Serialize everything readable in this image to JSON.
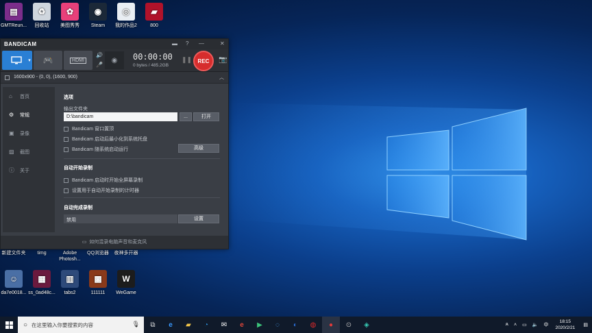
{
  "desktop": {
    "top_icons": [
      {
        "label": "GMTReun...",
        "color": "#7b2d8b",
        "glyph": "▤"
      },
      {
        "label": "回收站",
        "color": "#cfd6de",
        "glyph": "♻"
      },
      {
        "label": "美图秀秀",
        "color": "#e8407a",
        "glyph": "✿"
      },
      {
        "label": "Steam",
        "color": "#1b2838",
        "glyph": "◉"
      },
      {
        "label": "我的作品2",
        "color": "#e9eef3",
        "glyph": "◎"
      },
      {
        "label": "800",
        "color": "#b0122a",
        "glyph": "▰"
      }
    ],
    "mid_labels": [
      "新建文件夹",
      "timg",
      "Adobe Photosh...",
      "QQ浏览器",
      "夜神多开器"
    ],
    "bottom_icons": [
      {
        "label": "da7e0018...",
        "color": "#4a6fa5",
        "glyph": "☺"
      },
      {
        "label": "ss_0ad48c...",
        "color": "#6b1a3e",
        "glyph": "▦"
      },
      {
        "label": "tabs2",
        "color": "#2e4a7a",
        "glyph": "▥"
      },
      {
        "label": "111111",
        "color": "#8a3a1a",
        "glyph": "▩"
      },
      {
        "label": "WeGame",
        "color": "#1c1c1c",
        "glyph": "W"
      }
    ]
  },
  "bandicam": {
    "logo": "BANDICAM",
    "timer": "00:00:00",
    "size": "0 bytes / 485.2GB",
    "rec_label": "REC",
    "resolution": "1600x900 - (0, 0), (1600, 900)",
    "sidebar": [
      {
        "label": "首页",
        "icon": "home-icon",
        "glyph": "⌂"
      },
      {
        "label": "常规",
        "icon": "gear-icon",
        "glyph": "⚙"
      },
      {
        "label": "录像",
        "icon": "video-icon",
        "glyph": "▣"
      },
      {
        "label": "截图",
        "icon": "image-icon",
        "glyph": "▨"
      },
      {
        "label": "关于",
        "icon": "info-icon",
        "glyph": "ⓘ"
      }
    ],
    "options_title": "选项",
    "output_folder_label": "输出文件夹",
    "output_folder_value": "D:\\bandicam",
    "browse_label": "...",
    "open_label": "打开",
    "checkboxes": [
      "Bandicam 窗口置顶",
      "Bandicam 启动后最小化到系统托盘",
      "Bandicam 随系统启动运行"
    ],
    "advanced_label": "高级",
    "auto_start_title": "自动开始录制",
    "auto_start_checkboxes": [
      "Bandicam 启动时开始全屏幕录制",
      "设置用于自动开始录制的计时器"
    ],
    "auto_complete_title": "自动完成录制",
    "auto_complete_value": "禁用",
    "settings_label": "设置",
    "footer": "如何混录电脑声音和麦克风"
  },
  "taskbar": {
    "search_placeholder": "在这里输入你要搜索的内容",
    "tray_lang": "中",
    "time": "18:15",
    "date": "2020/2/21"
  }
}
